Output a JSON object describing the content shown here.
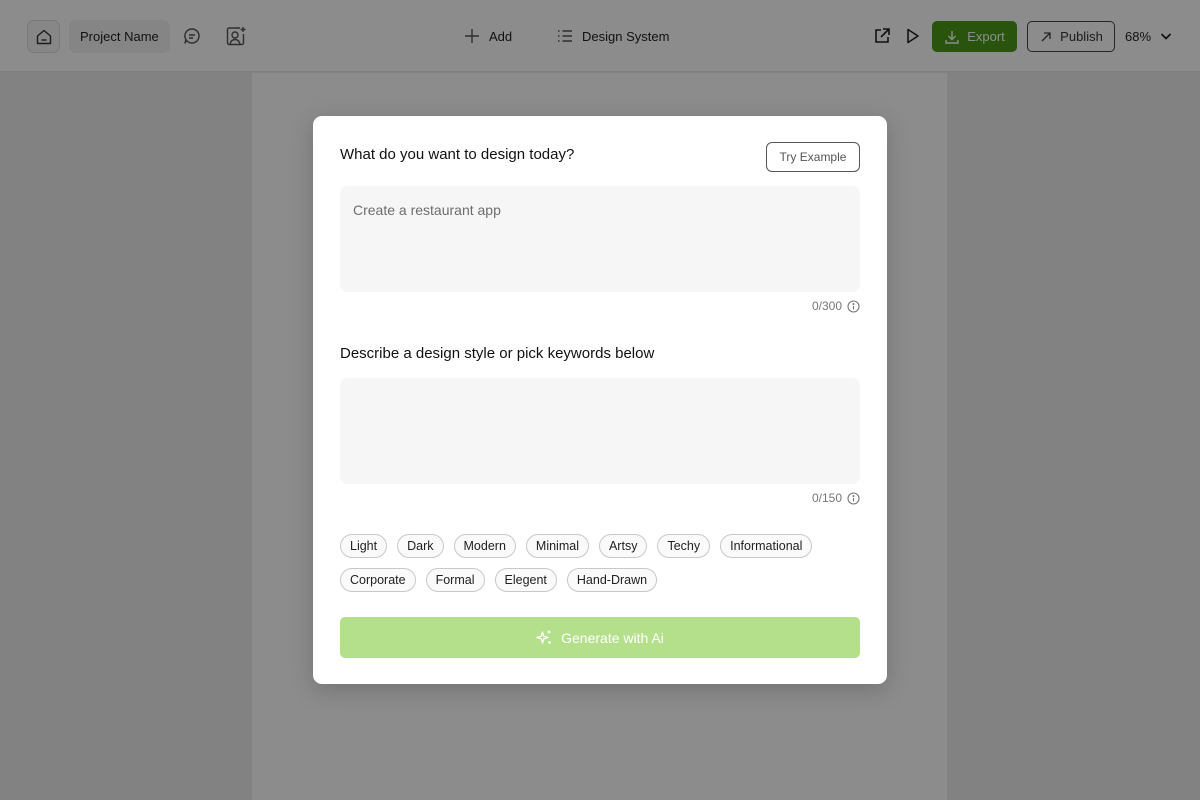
{
  "toolbar": {
    "project_name": "Project Name",
    "add_label": "Add",
    "design_system_label": "Design System",
    "export_label": "Export",
    "publish_label": "Publish",
    "zoom_level": "68%"
  },
  "modal": {
    "title": "What do you want to design today?",
    "try_example_label": "Try Example",
    "prompt_placeholder": "Create a restaurant app",
    "prompt_counter": "0/300",
    "style_title": "Describe a design style or pick keywords below",
    "style_placeholder": "",
    "style_counter": "0/150",
    "keywords_row1": [
      "Light",
      "Dark",
      "Modern",
      "Minimal",
      "Artsy",
      "Techy",
      "Informational"
    ],
    "keywords_row2": [
      "Corporate",
      "Formal",
      "Elegent",
      "Hand-Drawn"
    ],
    "generate_label": "Generate with Ai"
  },
  "colors": {
    "accent": "#4c9a19",
    "generate_disabled": "#b4e08c"
  }
}
